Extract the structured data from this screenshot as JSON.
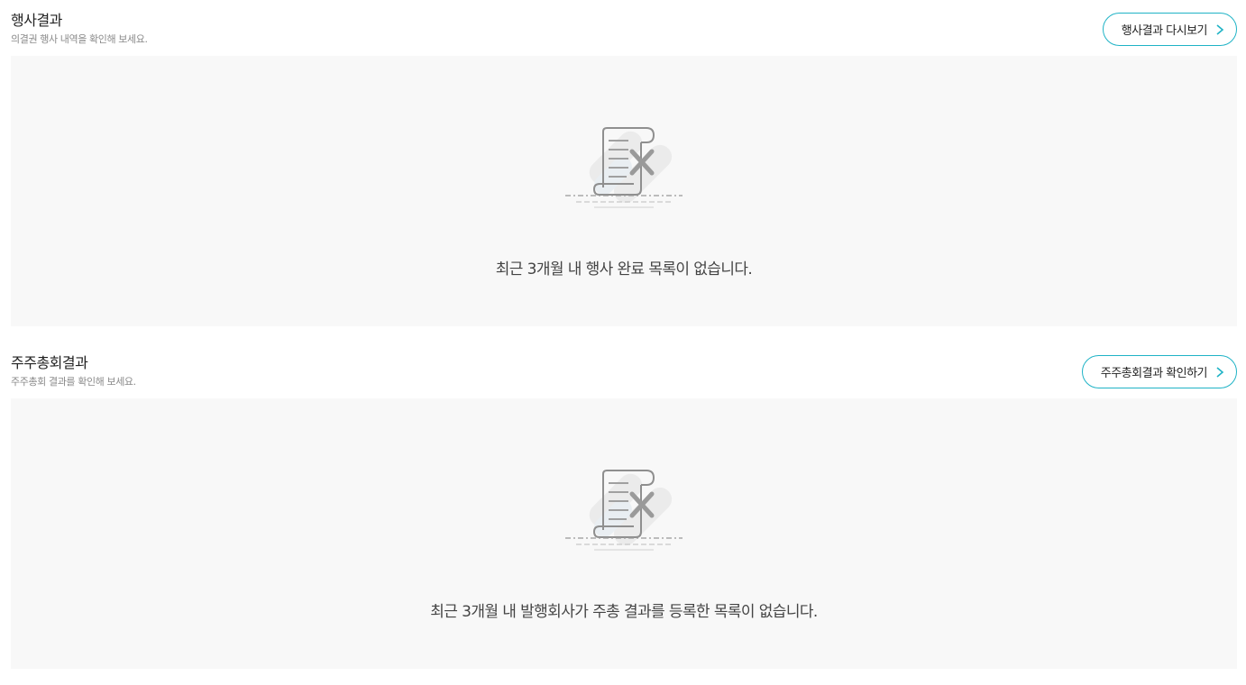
{
  "sections": [
    {
      "title": "행사결과",
      "subtitle": "의결권 행사 내역을 확인해 보세요.",
      "button_label": "행사결과 다시보기",
      "empty_message": "최근 3개월 내 행사 완료 목록이 없습니다."
    },
    {
      "title": "주주총회결과",
      "subtitle": "주주총회 결과를 확인해 보세요.",
      "button_label": "주주총회결과 확인하기",
      "empty_message": "최근 3개월 내 발행회사가 주총 결과를 등록한 목록이 없습니다."
    }
  ],
  "colors": {
    "accent": "#1fb3c6",
    "empty_bg": "#f8f8f8",
    "icon_gray": "#9a9a9a"
  },
  "icons": {
    "button_chevron": "chevron-right-icon",
    "empty_state": "empty-document-x-icon"
  }
}
